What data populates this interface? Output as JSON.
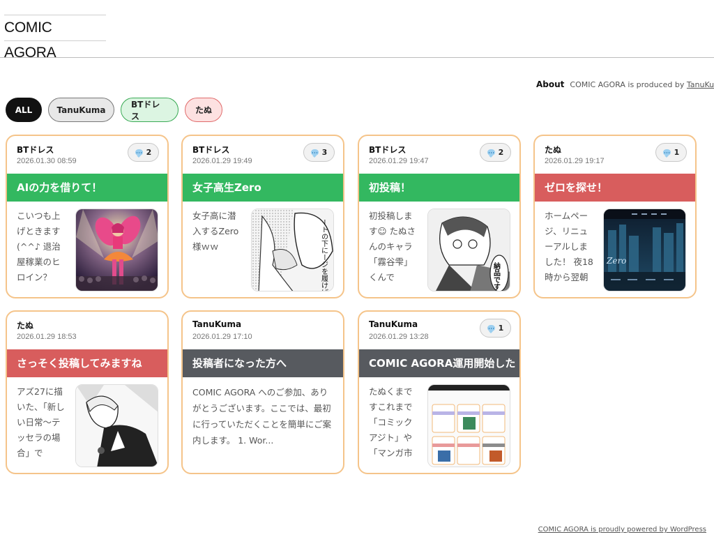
{
  "site": {
    "title": "COMIC AGORA"
  },
  "about": {
    "label": "About",
    "text": "COMIC AGORA is produced by ",
    "link": "TanuKuma"
  },
  "filters": [
    {
      "label": "ALL",
      "active": true
    },
    {
      "label": "TanuKuma"
    },
    {
      "label": "BTドレス"
    },
    {
      "label": "たぬ"
    }
  ],
  "posts": [
    {
      "author": "BTドレス",
      "date": "2026.01.30 08:59",
      "comments": "2",
      "title": "AIの力を借りて！",
      "color": "#33b860",
      "excerpt": "こいつも上げときます(^^♪ 退治屋稼業のヒロイン？"
    },
    {
      "author": "BTドレス",
      "date": "2026.01.29 19:49",
      "comments": "3",
      "title": "女子高生Zero",
      "color": "#33b860",
      "excerpt": "女子高に潜入するZero様ｗｗ",
      "thumb_text": "ートの下にージを履けばになるがう？"
    },
    {
      "author": "BTドレス",
      "date": "2026.01.29 19:47",
      "comments": "2",
      "title": "初投稿！",
      "color": "#33b860",
      "excerpt": "初投稿します☺ たぬさんのキャラ「霧谷雫」くんで",
      "thumb_text": "納品です"
    },
    {
      "author": "たぬ",
      "date": "2026.01.29 19:17",
      "comments": "1",
      "title": "ゼロを探せ！",
      "color": "#d85d5d",
      "excerpt": "ホームページ、リニューアルしました！ 夜18時から翌朝",
      "thumb_text": "Zero"
    },
    {
      "author": "たぬ",
      "date": "2026.01.29 18:53",
      "comments": "",
      "title": "さっそく投稿してみますね",
      "color": "#d85d5d",
      "excerpt": "アズ27に描いた、「新しい日常～テッセラの場合」で"
    },
    {
      "author": "TanuKuma",
      "date": "2026.01.29 17:10",
      "comments": "",
      "title": "投稿者になった方へ",
      "color": "#575a5f",
      "excerpt": "COMIC AGORA へのご参加、ありがとうございます。ここでは、最初に行っていただくことを簡単にご案内します。 1. Wor..."
    },
    {
      "author": "TanuKuma",
      "date": "2026.01.29 13:28",
      "comments": "1",
      "title": "COMIC AGORA運用開始した",
      "color": "#575a5f",
      "excerpt": "たぬくまですこれまで「コミックアジト」や「マンガ市"
    }
  ],
  "footer": {
    "text": "COMIC AGORA is proudly powered by WordPress"
  }
}
